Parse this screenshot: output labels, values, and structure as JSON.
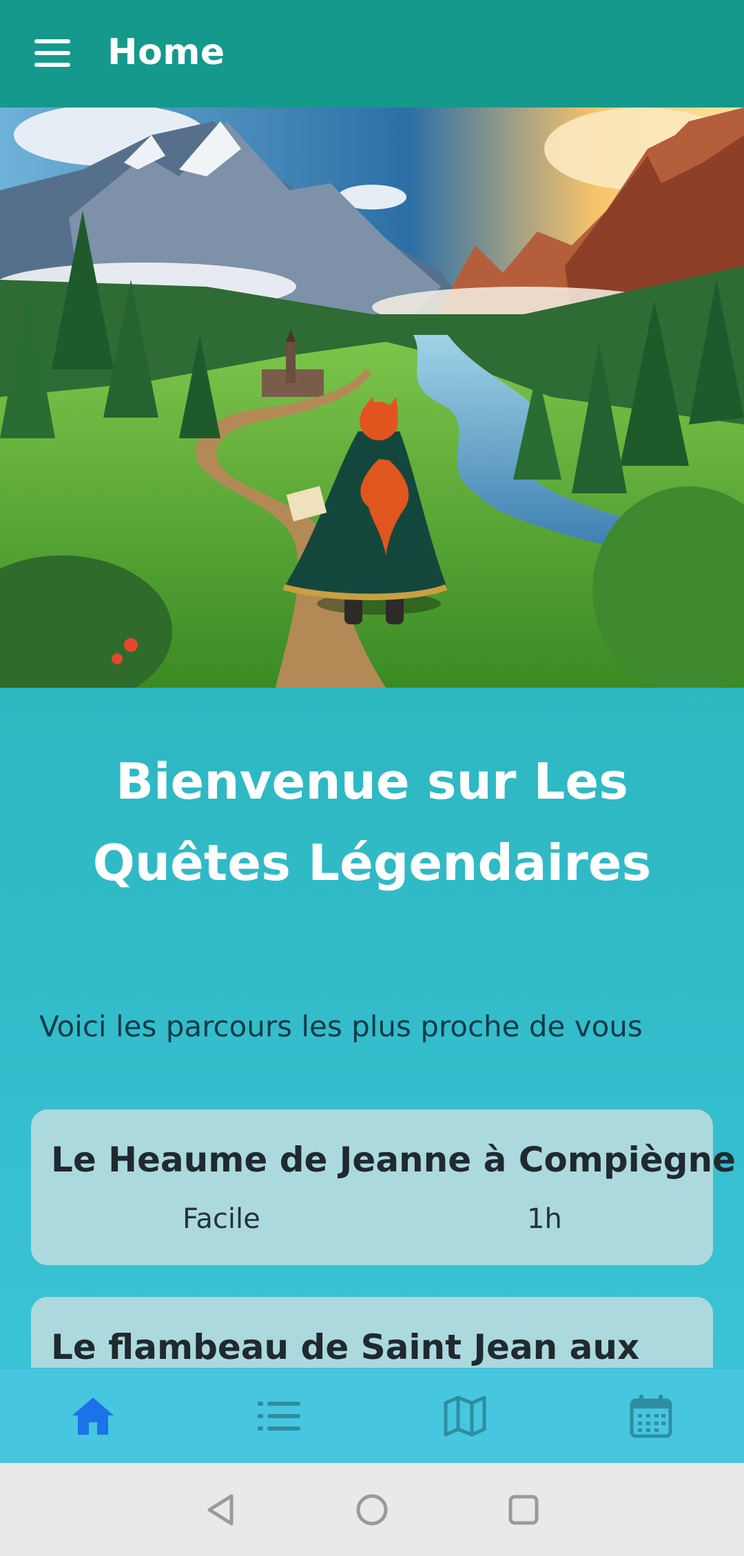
{
  "appbar": {
    "title": "Home",
    "menu_icon": "hamburger-menu-icon"
  },
  "hero": {
    "alt": "Fantasy landscape with caped adventurer"
  },
  "welcome": {
    "title": "Bienvenue sur Les Quêtes Légendaires"
  },
  "routes": {
    "subtitle": "Voici les parcours les plus proche de vous",
    "items": [
      {
        "title": "Le Heaume de Jeanne à Compiègne",
        "difficulty": "Facile",
        "duration": "1h"
      },
      {
        "title": "Le flambeau de Saint Jean aux"
      }
    ]
  },
  "bottom_nav": {
    "items": [
      {
        "icon": "home-icon",
        "active": true
      },
      {
        "icon": "list-icon",
        "active": false
      },
      {
        "icon": "map-icon",
        "active": false
      },
      {
        "icon": "calendar-icon",
        "active": false
      }
    ],
    "colors": {
      "active": "#1a73e8",
      "inactive": "#2e8ea0"
    }
  },
  "system_nav": {
    "back": "back-icon",
    "home": "circle-home-icon",
    "recents": "recents-icon"
  },
  "colors": {
    "appbar": "#14998c",
    "card": "#acd9dd",
    "accent": "#1a73e8"
  }
}
